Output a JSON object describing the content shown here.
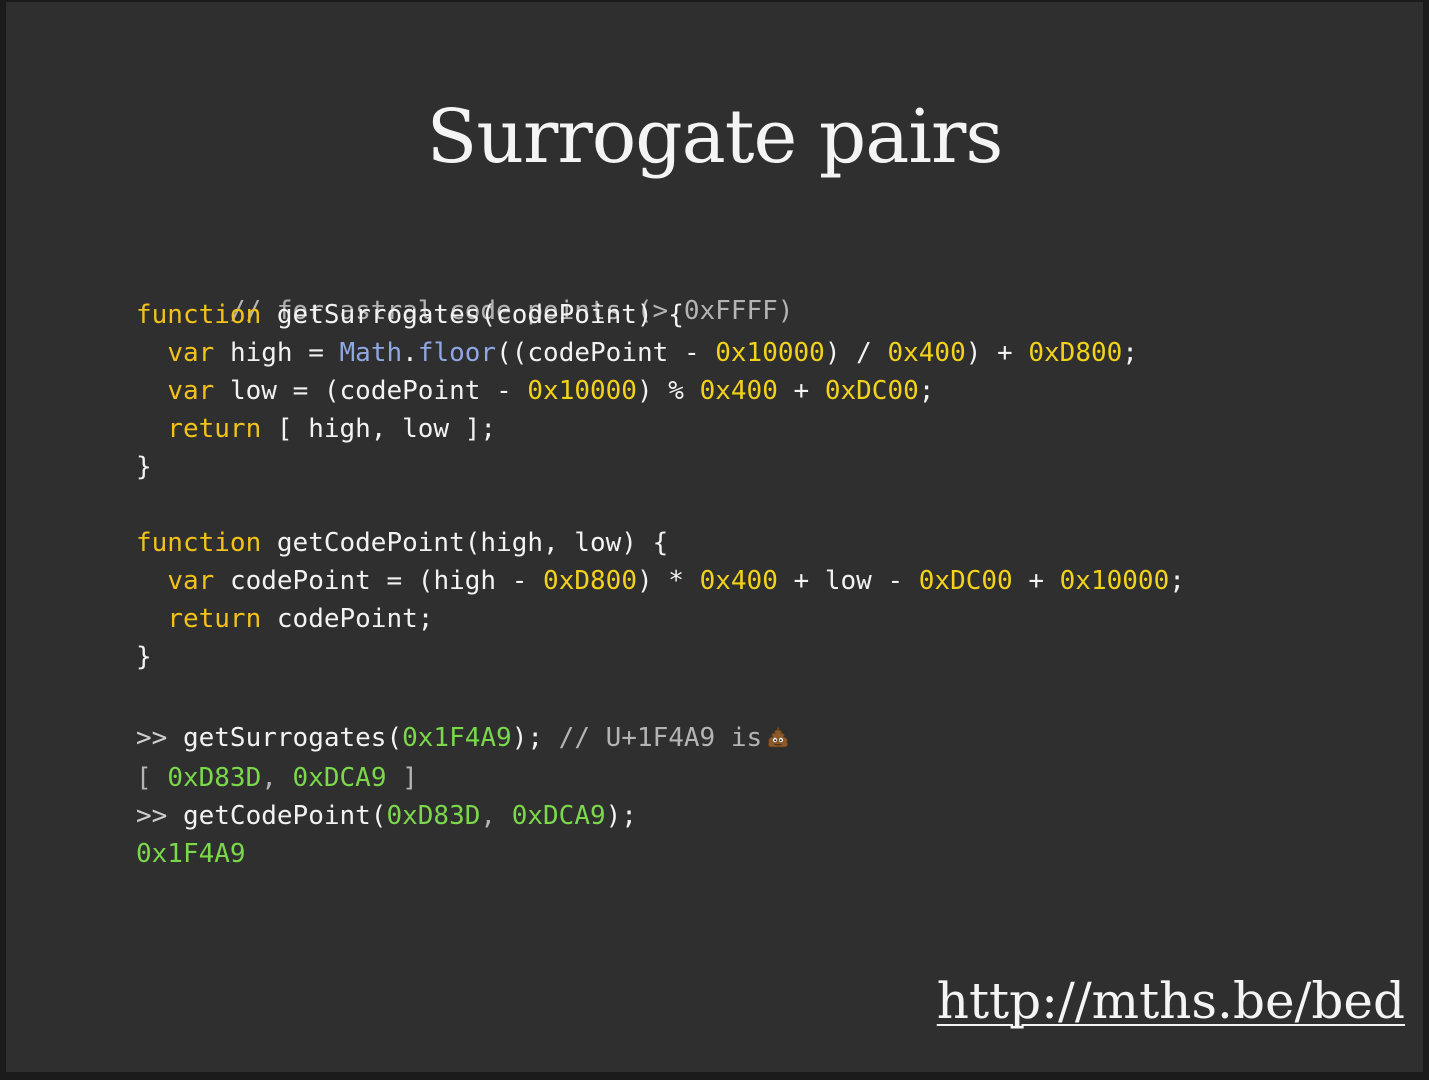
{
  "slide": {
    "title": "Surrogate pairs",
    "url": "http://mths.be/bed"
  },
  "code": {
    "comment_line": "// for astral code points (> 0xFFFF)",
    "fn1": {
      "keyword": "function",
      "signature": "getSurrogates(codePoint) {",
      "line1": {
        "kw": "var",
        "name": "high",
        "eq": "=",
        "math": "Math",
        "dot": ".",
        "floor": "floor",
        "open": "((codePoint",
        "minus": "-",
        "n1": "0x10000",
        "div": ") /",
        "n2": "0x400",
        "plus": ") +",
        "n3": "0xD800",
        "end": ";"
      },
      "line2": {
        "kw": "var",
        "name": "low",
        "eq": "=",
        "open": "(codePoint",
        "minus": "-",
        "n1": "0x10000",
        "mod": ") %",
        "n2": "0x400",
        "plus": "+",
        "n3": "0xDC00",
        "end": ";"
      },
      "line3": {
        "kw": "return",
        "rest": "[ high, low ];"
      },
      "close": "}"
    },
    "fn2": {
      "keyword": "function",
      "signature": "getCodePoint(high, low) {",
      "line1": {
        "kw": "var",
        "name": "codePoint",
        "eq": "=",
        "open": "(high",
        "minus": "-",
        "n1": "0xD800",
        "mul": ") *",
        "n2": "0x400",
        "plus1": "+ low -",
        "n3": "0xDC00",
        "plus2": "+",
        "n4": "0x10000",
        "end": ";"
      },
      "line2": {
        "kw": "return",
        "rest": "codePoint;"
      },
      "close": "}"
    },
    "console": {
      "prompt": ">>",
      "call1_fn": "getSurrogates(",
      "call1_arg": "0x1F4A9",
      "call1_end": ");",
      "call1_comment": "// U+1F4A9 is",
      "emoji_icon": "pile-of-poo-icon",
      "result1_open": "[",
      "result1_a": "0xD83D",
      "result1_sep": ",",
      "result1_b": "0xDCA9",
      "result1_close": "]",
      "call2_fn": "getCodePoint(",
      "call2_arg1": "0xD83D",
      "call2_sep": ",",
      "call2_arg2": "0xDCA9",
      "call2_end": ");",
      "result2": "0x1F4A9"
    }
  },
  "colors": {
    "background": "#2f2f2f",
    "keyword": "#f2c21b",
    "number": "#f2d21b",
    "builtin": "#8fa7e3",
    "console_value": "#7ad84a",
    "comment": "#b4b4b4"
  }
}
